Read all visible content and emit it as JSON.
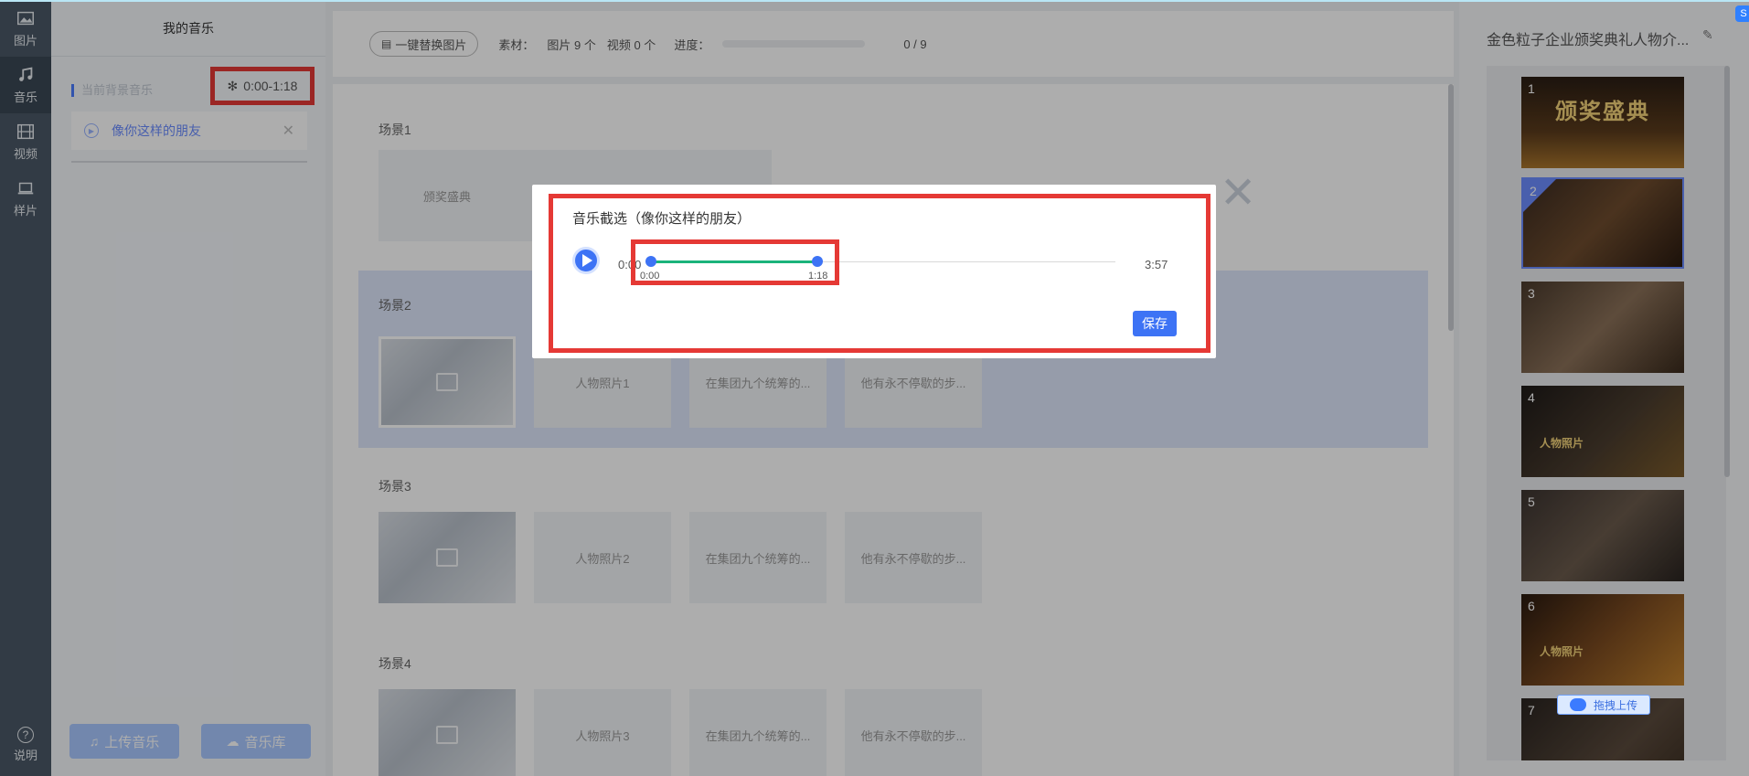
{
  "rail": {
    "items": [
      {
        "label": "图片",
        "icon": "image-icon"
      },
      {
        "label": "音乐",
        "icon": "music-icon"
      },
      {
        "label": "视频",
        "icon": "film-icon"
      },
      {
        "label": "样片",
        "icon": "monitor-icon"
      }
    ],
    "help": "说明"
  },
  "music_panel": {
    "title": "我的音乐",
    "current_label": "当前背景音乐",
    "time_range": "0:00-1:18",
    "song": "像你这样的朋友",
    "upload_btn": "上传音乐",
    "library_btn": "音乐库"
  },
  "toolbar": {
    "replace_btn": "一键替换图片",
    "material_label": "素材：",
    "images": "图片 9 个",
    "videos": "视频 0 个",
    "progress_label": "进度：",
    "progress_value": 0,
    "progress_count": "0 / 9"
  },
  "scenes": [
    {
      "title": "场景1",
      "cards": [
        "颁奖盛典",
        "",
        ""
      ]
    },
    {
      "title": "场景2",
      "cards": [
        "",
        "人物照片1",
        "在集团九个统筹的...",
        "他有永不停歇的步..."
      ]
    },
    {
      "title": "场景3",
      "cards": [
        "",
        "人物照片2",
        "在集团九个统筹的...",
        "他有永不停歇的步..."
      ]
    },
    {
      "title": "场景4",
      "cards": [
        "",
        "人物照片3",
        "在集团九个统筹的...",
        "他有永不停歇的步..."
      ]
    }
  ],
  "right": {
    "project_title": "金色粒子企业颁奖典礼人物介...",
    "thumbs": [
      {
        "num": "1",
        "big": "颁奖盛典",
        "mid": ""
      },
      {
        "num": "2",
        "big": "",
        "mid": ""
      },
      {
        "num": "3",
        "big": "",
        "mid": ""
      },
      {
        "num": "4",
        "big": "",
        "mid": "人物照片"
      },
      {
        "num": "5",
        "big": "",
        "mid": ""
      },
      {
        "num": "6",
        "big": "",
        "mid": "人物照片"
      },
      {
        "num": "7",
        "big": "",
        "mid": ""
      }
    ],
    "drag_upload": "拖拽上传"
  },
  "modal": {
    "title": "音乐截选（像你这样的朋友）",
    "start": "0:00",
    "sel_start_label": "0:00",
    "sel_end_label": "1:18",
    "end": "3:57",
    "selection_start_fraction": 0.0,
    "selection_end_fraction": 0.33,
    "save": "保存"
  }
}
